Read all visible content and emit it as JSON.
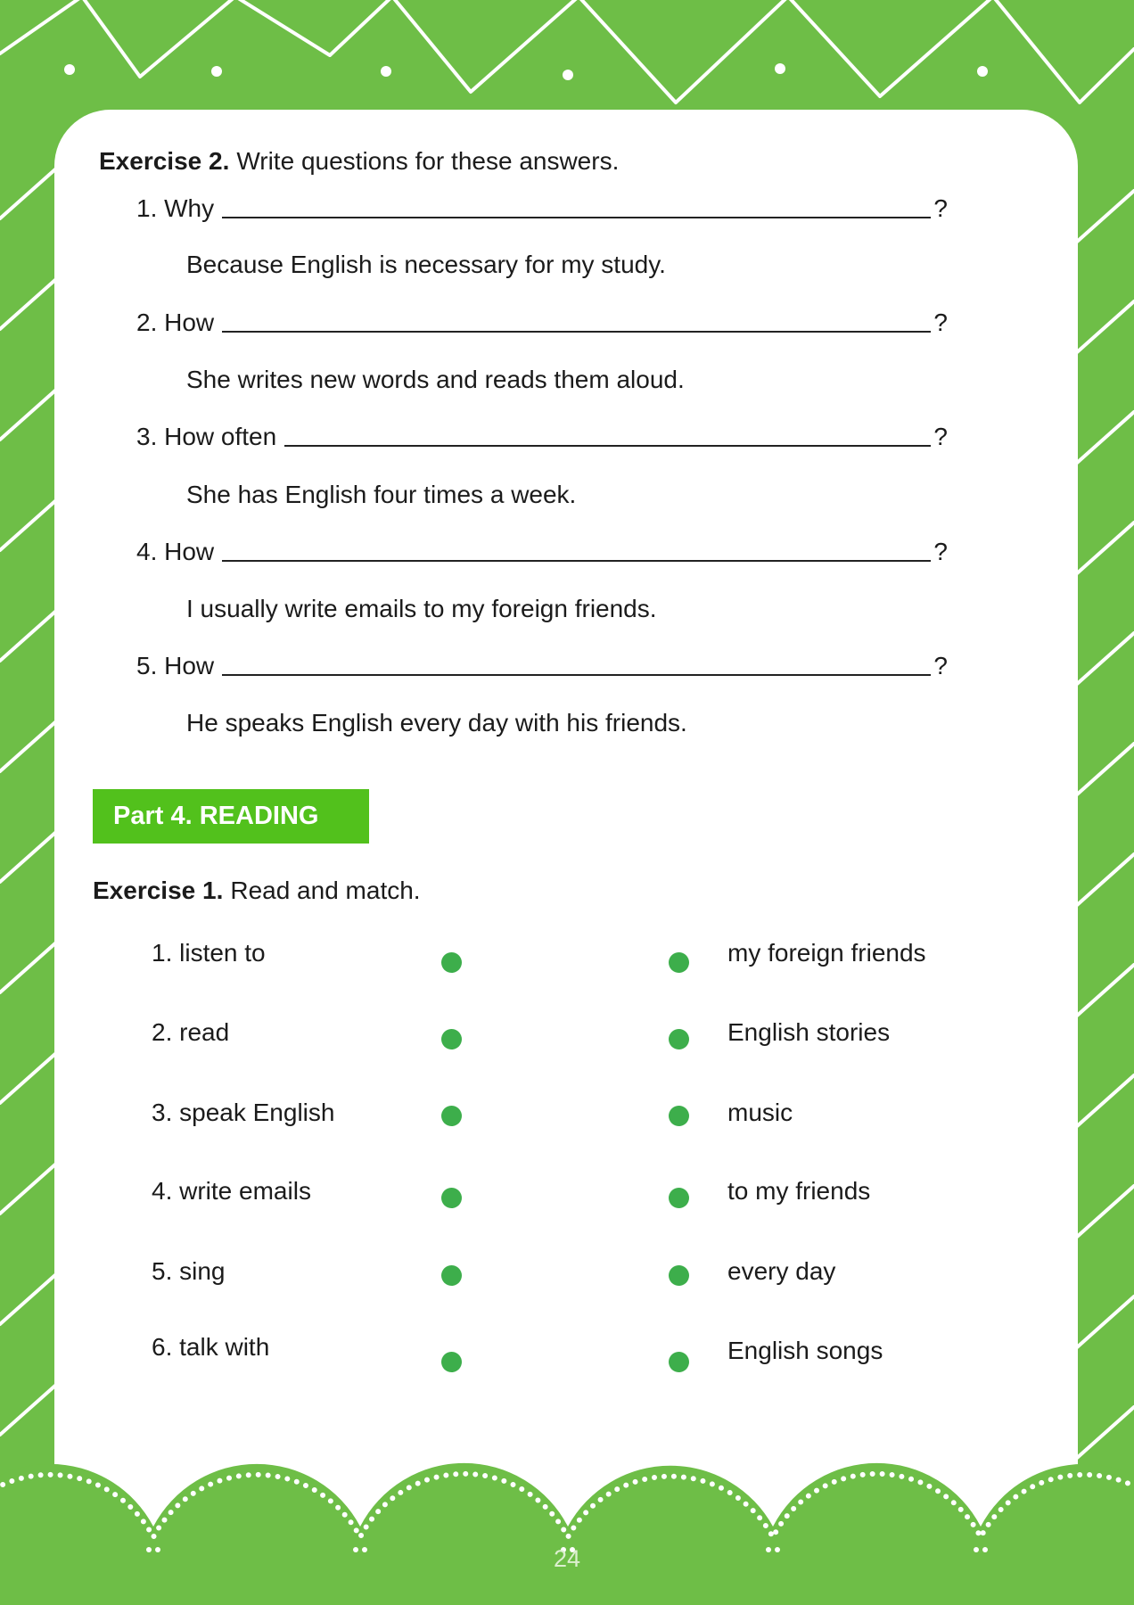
{
  "theme": {
    "background": "#6ebe47",
    "panel": "#ffffff",
    "section_label_bg": "#52c11c",
    "match_dot": "#3dae4b",
    "text": "#1b1b1b",
    "page_number": "#dcefcf"
  },
  "exercise2": {
    "label": "Exercise 2.",
    "instruction": "Write questions for these answers.",
    "items": [
      {
        "prompt": "1. Why",
        "end_mark": "?",
        "answer": "Because English is necessary for my study."
      },
      {
        "prompt": "2. How",
        "end_mark": "?",
        "answer": "She writes new words and reads them aloud."
      },
      {
        "prompt": "3. How often",
        "end_mark": "?",
        "answer": "She has English four times a week."
      },
      {
        "prompt": "4. How",
        "end_mark": "?",
        "answer": "I usually write emails to my foreign friends."
      },
      {
        "prompt": "5. How",
        "end_mark": "?",
        "answer": "He speaks English every day with his friends."
      }
    ]
  },
  "part4": {
    "label": "Part 4. READING"
  },
  "exercise1": {
    "label": "Exercise 1.",
    "instruction": "Read and match.",
    "left_items": [
      "1. listen to",
      "2. read",
      "3. speak English",
      "4. write emails",
      "5. sing",
      "6. talk with"
    ],
    "right_items": [
      "my foreign friends",
      "English stories",
      "music",
      "to my friends",
      "every day",
      "English songs"
    ]
  },
  "page": {
    "number": "24"
  }
}
